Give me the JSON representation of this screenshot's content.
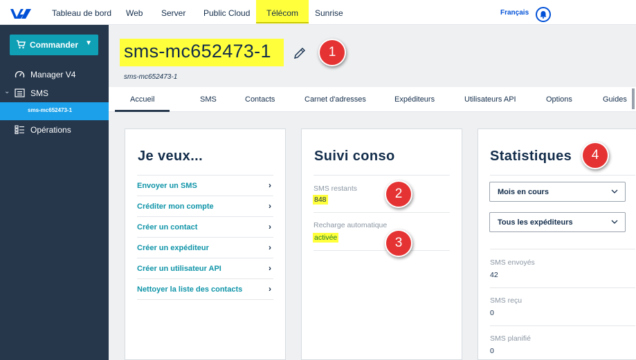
{
  "topnav": {
    "items": [
      "Tableau de bord",
      "Web",
      "Server",
      "Public Cloud",
      "Télécom",
      "Sunrise"
    ],
    "language": "Français"
  },
  "sidebar": {
    "order_button": "Commander",
    "items": [
      "Manager V4",
      "SMS",
      "sms-mc652473-1",
      "Opérations"
    ]
  },
  "header": {
    "title": "sms-mc652473-1",
    "subtitle": "sms-mc652473-1"
  },
  "tabs": [
    "Accueil",
    "SMS",
    "Contacts",
    "Carnet d'adresses",
    "Expéditeurs",
    "Utilisateurs API",
    "Options",
    "Guides"
  ],
  "callouts": [
    "1",
    "2",
    "3",
    "4"
  ],
  "je_veux": {
    "title": "Je veux...",
    "links": [
      "Envoyer un SMS",
      "Créditer mon compte",
      "Créer un contact",
      "Créer un expéditeur",
      "Créer un utilisateur API",
      "Nettoyer la liste des contacts"
    ]
  },
  "suivi": {
    "title": "Suivi conso",
    "remaining_label": "SMS restants",
    "remaining_value": "848",
    "recharge_label": "Recharge automatique",
    "recharge_value": "activée"
  },
  "stats": {
    "title": "Statistiques",
    "period_select": "Mois en cours",
    "sender_select": "Tous les expéditeurs",
    "rows": [
      {
        "label": "SMS envoyés",
        "value": "42"
      },
      {
        "label": "SMS reçu",
        "value": "0"
      },
      {
        "label": "SMS planifié",
        "value": "0"
      }
    ]
  },
  "colors": {
    "highlight": "#ffff3c",
    "sidebar": "#26374c",
    "accent": "#0fa0b6",
    "callout": "#e53333",
    "link": "#0f94a8"
  }
}
